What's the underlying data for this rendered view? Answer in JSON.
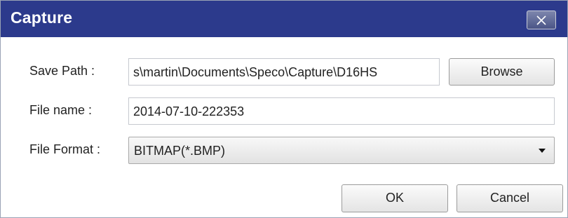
{
  "window": {
    "title": "Capture",
    "close_icon": "close-icon"
  },
  "form": {
    "save_path": {
      "label": "Save Path :",
      "value": "s\\martin\\Documents\\Speco\\Capture\\D16HS"
    },
    "file_name": {
      "label": "File name :",
      "value": "2014-07-10-222353"
    },
    "file_format": {
      "label": "File Format :",
      "value": "BITMAP(*.BMP)"
    }
  },
  "buttons": {
    "browse": "Browse",
    "ok": "OK",
    "cancel": "Cancel"
  },
  "colors": {
    "titlebar": "#2c3a8c",
    "title_text": "#ffffff"
  }
}
